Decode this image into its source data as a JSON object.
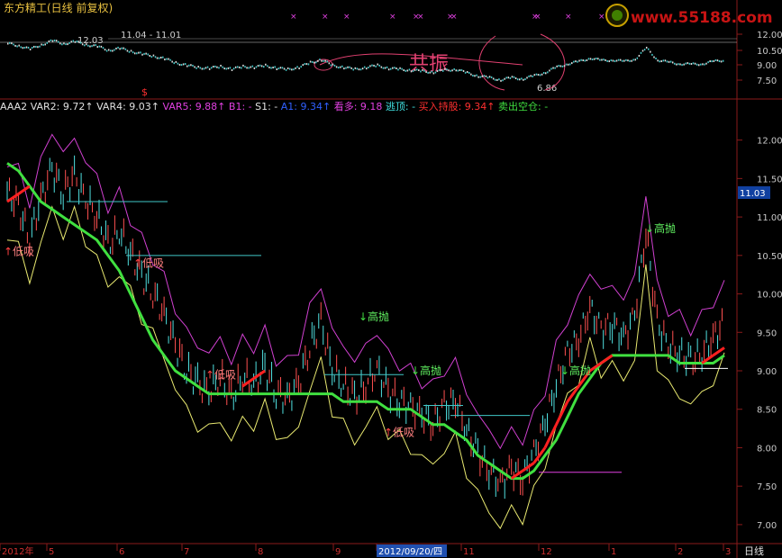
{
  "header": {
    "title": "东方精工(日线 前复权)",
    "watermark": "www.55188.com",
    "watermark_color": "#c81414",
    "logo_icon": "bull-head-logo-icon"
  },
  "top_panel": {
    "label_high": "12.03",
    "label_range": "11.04 - 11.01",
    "label_low": "6.86",
    "resonance_text": "共振",
    "axis_ticks": [
      "12.00",
      "10.50",
      "9.00",
      "7.50"
    ],
    "marker_symbol": "×"
  },
  "indicator_bar": {
    "items": [
      {
        "text": "AAA2",
        "color": "#e0e0e0"
      },
      {
        "text": "VAR2: 9.72↑",
        "color": "#e0e0e0"
      },
      {
        "text": "VAR4: 9.03↑",
        "color": "#e0e0e0"
      },
      {
        "text": "VAR5: 9.88↑",
        "color": "#e040e0"
      },
      {
        "text": "B1: -",
        "color": "#e040e0"
      },
      {
        "text": "S1: -",
        "color": "#e0e0e0"
      },
      {
        "text": "A1: 9.34↑",
        "color": "#3060ff"
      },
      {
        "text": "看多: 9.18",
        "color": "#e040e0"
      },
      {
        "text": "逃顶: -",
        "color": "#40e0e0"
      },
      {
        "text": "买入持股: 9.34↑",
        "color": "#ff3030"
      },
      {
        "text": "卖出空仓: -",
        "color": "#40e040"
      }
    ]
  },
  "main_axis": {
    "ticks": [
      "12.00",
      "11.50",
      "11.00",
      "10.50",
      "10.00",
      "9.50",
      "9.00",
      "8.50",
      "8.00",
      "7.50",
      "7.00"
    ],
    "current_price": "11.03"
  },
  "signals": [
    {
      "text": "低吸",
      "type": "buy"
    },
    {
      "text": "低吸",
      "type": "buy"
    },
    {
      "text": "低吸",
      "type": "buy"
    },
    {
      "text": "低吸",
      "type": "buy"
    },
    {
      "text": "高抛",
      "type": "sell"
    },
    {
      "text": "高抛",
      "type": "sell"
    },
    {
      "text": "高抛",
      "type": "sell"
    },
    {
      "text": "高抛",
      "type": "sell"
    }
  ],
  "x_axis": {
    "labels": [
      "2012年",
      "5",
      "6",
      "7",
      "8",
      "9",
      "2012/09/20/四",
      "11",
      "12",
      "1",
      "2",
      "3"
    ],
    "period_label": "日线"
  },
  "chart_data": {
    "type": "line",
    "ylim": [
      6.8,
      12.3
    ],
    "series": [
      {
        "values": [
          11.3,
          11.1,
          10.7,
          11.2,
          11.6,
          11.3,
          11.5,
          11.2,
          11.0,
          10.6,
          10.8,
          10.5,
          10.2,
          10.0,
          9.7,
          9.3,
          9.0,
          8.8,
          8.7,
          8.9,
          8.6,
          8.9,
          8.8,
          9.0,
          8.7,
          8.6,
          8.8,
          9.3,
          9.6,
          9.0,
          8.8,
          8.6,
          8.8,
          9.0,
          8.7,
          8.6,
          8.5,
          8.4,
          8.3,
          8.5,
          8.6,
          8.2,
          7.9,
          7.7,
          7.5,
          7.7,
          7.6,
          7.9,
          8.3,
          8.8,
          9.2,
          9.4,
          9.8,
          9.5,
          9.6,
          9.4,
          9.7,
          10.8,
          9.6,
          9.3,
          9.2,
          9.1,
          9.2,
          9.4,
          9.6
        ]
      },
      {
        "values": [
          11.7,
          11.6,
          11.4,
          11.2,
          11.1,
          11.0,
          10.9,
          10.8,
          10.7,
          10.5,
          10.3,
          10.0,
          9.7,
          9.4,
          9.2,
          9.0,
          8.9,
          8.8,
          8.7,
          8.7,
          8.7,
          8.7,
          8.7,
          8.7,
          8.7,
          8.7,
          8.7,
          8.7,
          8.7,
          8.7,
          8.6,
          8.6,
          8.6,
          8.6,
          8.5,
          8.5,
          8.5,
          8.4,
          8.3,
          8.3,
          8.2,
          8.1,
          7.9,
          7.8,
          7.7,
          7.6,
          7.6,
          7.7,
          7.9,
          8.1,
          8.4,
          8.7,
          8.9,
          9.1,
          9.2,
          9.2,
          9.2,
          9.2,
          9.2,
          9.2,
          9.1,
          9.1,
          9.1,
          9.1,
          9.2
        ]
      },
      {
        "values": [
          11.2,
          11.3,
          11.4,
          11.2,
          11.0,
          10.8,
          10.6,
          10.4,
          10.2,
          10.0,
          9.8,
          9.6,
          9.4,
          9.2,
          9.0,
          8.9,
          8.9,
          8.9,
          8.8,
          8.8,
          8.8,
          8.8,
          8.9,
          9.0,
          9.0,
          8.9,
          8.8,
          8.7,
          8.6,
          8.6,
          8.6,
          8.6,
          8.6,
          8.5,
          8.5,
          8.4,
          8.4,
          8.3,
          8.2,
          8.1,
          8.0,
          7.9,
          7.8,
          7.7,
          7.6,
          7.6,
          7.7,
          7.8,
          8.0,
          8.3,
          8.6,
          8.8,
          9.0,
          9.1,
          9.2,
          9.2,
          9.2,
          9.2,
          9.2,
          9.2,
          9.1,
          9.1,
          9.1,
          9.2,
          9.3
        ]
      }
    ]
  }
}
